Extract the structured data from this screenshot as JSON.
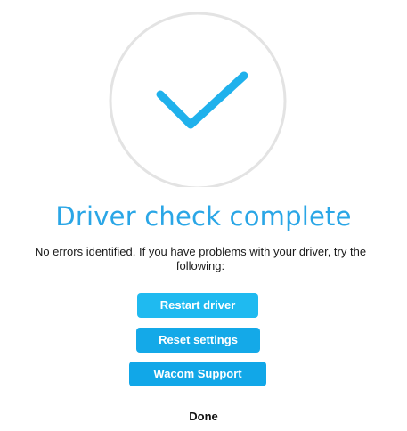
{
  "result": {
    "title": "Driver check complete",
    "message": "No errors identified. If you have problems with your driver, try the following:"
  },
  "actions": {
    "restart_label": "Restart driver",
    "reset_label": "Reset settings",
    "support_label": "Wacom Support"
  },
  "footer": {
    "done_label": "Done"
  },
  "icons": {
    "status": "checkmark-icon"
  },
  "colors": {
    "accent": "#1fb1ec",
    "title": "#2aa6e6",
    "circle": "#e3e3e3"
  }
}
